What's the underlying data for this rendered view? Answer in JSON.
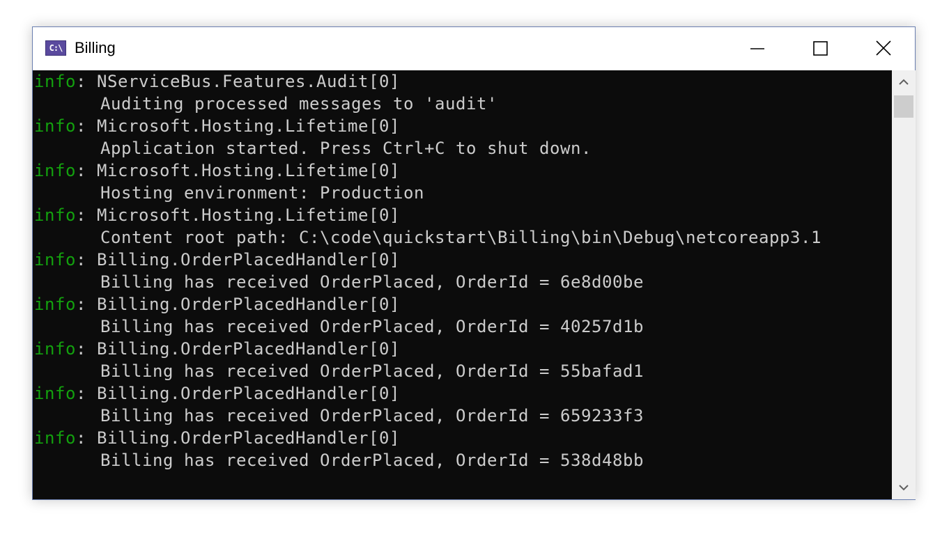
{
  "window": {
    "title": "Billing",
    "icon": "console-app-icon",
    "icon_text": "C:\\",
    "controls": {
      "minimize": "minimize-icon",
      "maximize": "maximize-icon",
      "close": "close-icon"
    }
  },
  "console": {
    "colors": {
      "background": "#0c0c0c",
      "text": "#cccccc",
      "level": "#13a10e"
    },
    "entries": [
      {
        "level": "info",
        "category": "NServiceBus.Features.Audit[0]",
        "message": "Auditing processed messages to 'audit'"
      },
      {
        "level": "info",
        "category": "Microsoft.Hosting.Lifetime[0]",
        "message": "Application started. Press Ctrl+C to shut down."
      },
      {
        "level": "info",
        "category": "Microsoft.Hosting.Lifetime[0]",
        "message": "Hosting environment: Production"
      },
      {
        "level": "info",
        "category": "Microsoft.Hosting.Lifetime[0]",
        "message": "Content root path: C:\\code\\quickstart\\Billing\\bin\\Debug\\netcoreapp3.1"
      },
      {
        "level": "info",
        "category": "Billing.OrderPlacedHandler[0]",
        "message": "Billing has received OrderPlaced, OrderId = 6e8d00be"
      },
      {
        "level": "info",
        "category": "Billing.OrderPlacedHandler[0]",
        "message": "Billing has received OrderPlaced, OrderId = 40257d1b"
      },
      {
        "level": "info",
        "category": "Billing.OrderPlacedHandler[0]",
        "message": "Billing has received OrderPlaced, OrderId = 55bafad1"
      },
      {
        "level": "info",
        "category": "Billing.OrderPlacedHandler[0]",
        "message": "Billing has received OrderPlaced, OrderId = 659233f3"
      },
      {
        "level": "info",
        "category": "Billing.OrderPlacedHandler[0]",
        "message": "Billing has received OrderPlaced, OrderId = 538d48bb"
      }
    ]
  },
  "scrollbar": {
    "up": "chevron-up-icon",
    "down": "chevron-down-icon"
  }
}
